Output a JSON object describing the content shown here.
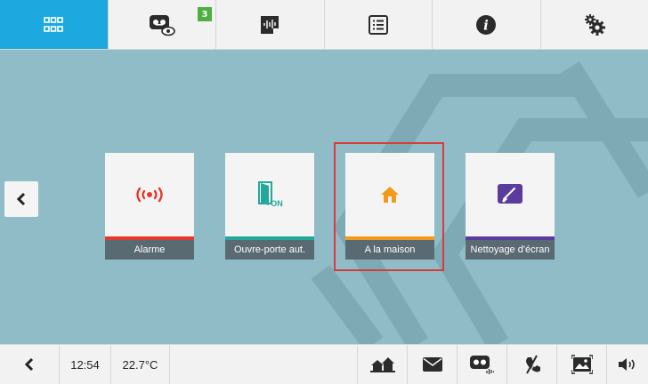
{
  "topbar": {
    "tabs": [
      {
        "icon": "apps-grid-icon",
        "active": true
      },
      {
        "icon": "video-memo-icon",
        "active": false,
        "badge": "3"
      },
      {
        "icon": "voice-memo-icon",
        "active": false
      },
      {
        "icon": "list-icon",
        "active": false
      },
      {
        "icon": "info-icon",
        "active": false
      },
      {
        "icon": "settings-gears-icon",
        "active": false
      }
    ]
  },
  "tiles": [
    {
      "label": "Alarme",
      "icon": "alarm-signal-icon",
      "accent": "#e23b2e"
    },
    {
      "label": "Ouvre-porte aut.",
      "icon": "auto-door-opener-icon",
      "icon_text": "ON",
      "accent": "#23a89a"
    },
    {
      "label": "A la maison",
      "icon": "home-icon",
      "accent": "#f29a1c"
    },
    {
      "label": "Nettoyage d'écran",
      "icon": "screen-cleaning-icon",
      "accent": "#5b3c9e"
    }
  ],
  "selected_tile": "A la maison",
  "bottombar": {
    "time": "12:54",
    "temperature": "22.7°C"
  },
  "colors": {
    "active_tab": "#1ea8e0",
    "background": "#8fbcc6",
    "selection_frame": "#d93a3a"
  }
}
